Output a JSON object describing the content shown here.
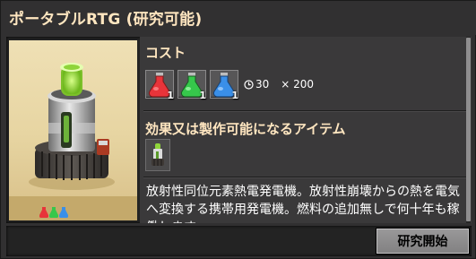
{
  "window": {
    "title": "ポータブルRTG (研究可能)"
  },
  "cost": {
    "heading": "コスト",
    "ingredients": [
      {
        "name": "red-science-pack-icon",
        "color": "#e8343a",
        "count": "1"
      },
      {
        "name": "green-science-pack-icon",
        "color": "#36c74b",
        "count": "1"
      },
      {
        "name": "blue-science-pack-icon",
        "color": "#3a8fe8",
        "count": "1"
      }
    ],
    "time": "30",
    "multiplier": "× 200"
  },
  "effects": {
    "heading": "効果又は製作可能になるアイテム",
    "item_icon": "portable-rtg-icon"
  },
  "description": "放射性同位元素熱電発電機。放射性崩壊からの熱を電気へ変換する携帯用発電機。燃料の追加無しで何十年も稼働します。",
  "footer": {
    "research_button_label": "研究開始"
  },
  "colors": {
    "title": "#ffe6c0",
    "accent_preview": "#e7d5a2"
  }
}
